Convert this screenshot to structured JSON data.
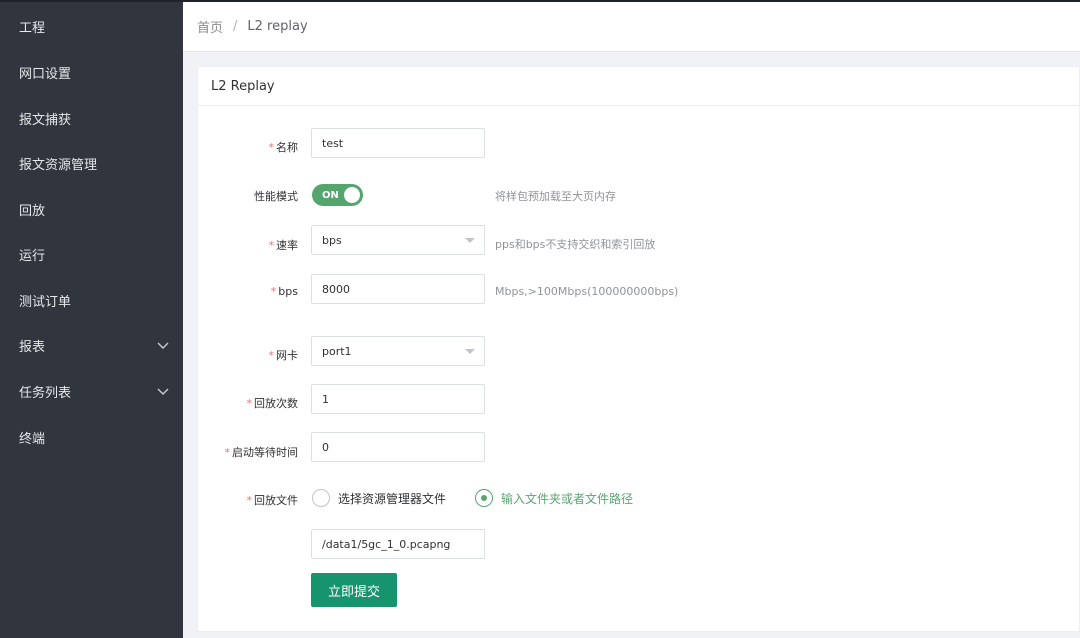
{
  "sidebar": {
    "items": [
      {
        "label": "工程"
      },
      {
        "label": "网口设置"
      },
      {
        "label": "报文捕获"
      },
      {
        "label": "报文资源管理"
      },
      {
        "label": "回放"
      },
      {
        "label": "运行"
      },
      {
        "label": "测试订单"
      },
      {
        "label": "报表"
      },
      {
        "label": "任务列表"
      },
      {
        "label": "终端"
      }
    ]
  },
  "breadcrumb": {
    "home": "首页",
    "separator": "/",
    "current": "L2 replay"
  },
  "card": {
    "title": "L2 Replay"
  },
  "form": {
    "required_mark": "*",
    "name": {
      "label": "名称",
      "value": "test"
    },
    "perf_mode": {
      "label": "性能模式",
      "switch_text": "ON",
      "hint": "将样包预加载至大页内存"
    },
    "rate": {
      "label": "速率",
      "value": "bps",
      "hint": "pps和bps不支持交织和索引回放"
    },
    "bps": {
      "label": "bps",
      "value": "8000",
      "hint": "Mbps,>100Mbps(100000000bps)"
    },
    "nic": {
      "label": "网卡",
      "value": "port1"
    },
    "replay_count": {
      "label": "回放次数",
      "value": "1"
    },
    "start_wait": {
      "label": "启动等待时间",
      "value": "0"
    },
    "replay_file": {
      "label": "回放文件",
      "option_resource": "选择资源管理器文件",
      "option_path": "输入文件夹或者文件路径",
      "path_value": "/data1/5gc_1_0.pcapng"
    },
    "submit_label": "立即提交"
  },
  "colors": {
    "sidebar_bg": "#30353e",
    "accent_green": "#56a56f",
    "submit_button": "#16946e",
    "required": "#f56c6c"
  }
}
